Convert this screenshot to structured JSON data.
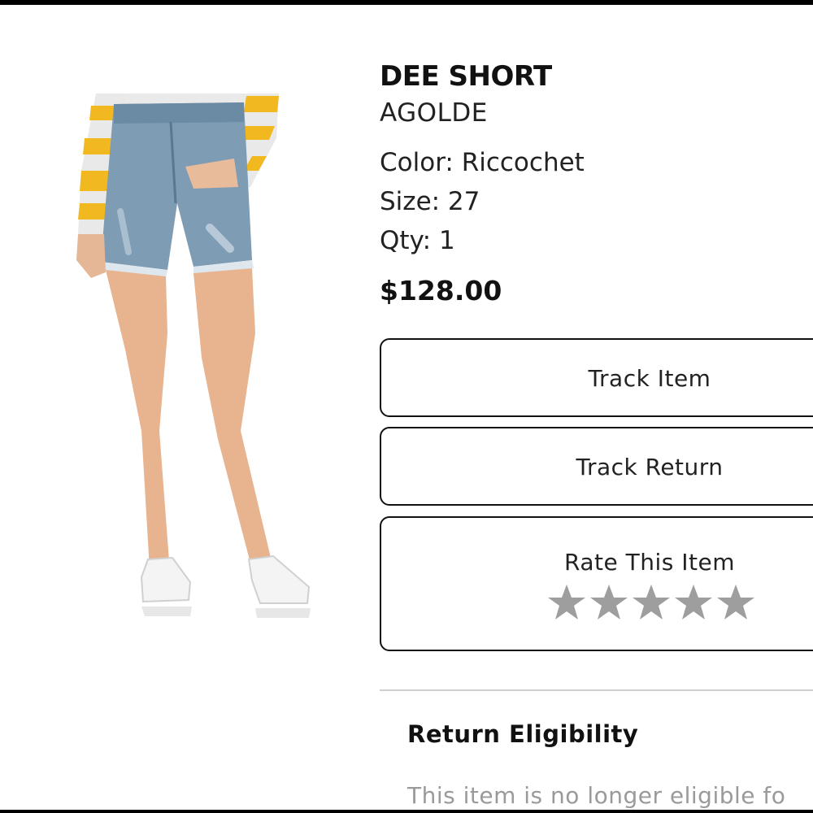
{
  "product": {
    "name": "DEE SHORT",
    "brand": "AGOLDE",
    "color_text": "Color: Riccochet",
    "size_text": "Size: 27",
    "qty_text": "Qty: 1",
    "price": "$128.00"
  },
  "actions": {
    "track_item_label": "Track Item",
    "track_return_label": "Track Return",
    "rate_label": "Rate This Item",
    "rating": {
      "max_stars": 5,
      "selected": 0,
      "star_color": "#9e9e9e"
    }
  },
  "return_section": {
    "heading": "Return Eligibility",
    "message": "This item is no longer eligible fo"
  },
  "colors": {
    "text_primary": "#111111",
    "text_muted": "#9a9a9a",
    "border": "#111111",
    "divider": "#cfcfcf",
    "sweater_stripe": "#f2b81f",
    "denim": "#7e9cb4"
  },
  "icons": {
    "star": "star-icon"
  }
}
